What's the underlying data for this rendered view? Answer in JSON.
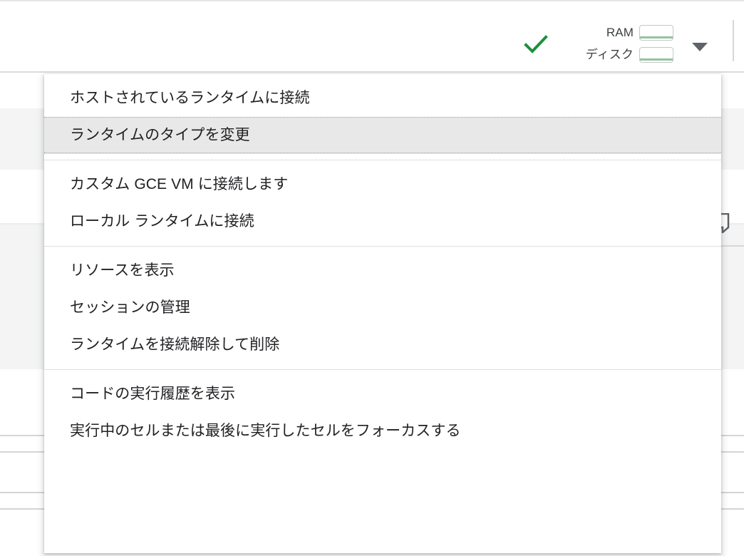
{
  "window": {
    "title": "Colab notebook - runtime menu open"
  },
  "toolbar": {
    "connected_icon": "check-icon",
    "connected_icon_color": "#1e8e3e",
    "resource_meters": [
      {
        "label": "RAM",
        "icon": "usage-bar-icon",
        "fill_color": "#93c49b"
      },
      {
        "label": "ディスク",
        "icon": "usage-bar-icon",
        "fill_color": "#93c49b"
      }
    ],
    "dropdown_caret": "chevron-down-icon"
  },
  "gutter": {
    "comment_icon": "comment-bubble-icon"
  },
  "menu": {
    "groups": [
      {
        "items": [
          {
            "label": "ホストされているランタイムに接続",
            "name": "menu-item-connect-hosted-runtime",
            "highlighted": false
          },
          {
            "label": "ランタイムのタイプを変更",
            "name": "menu-item-change-runtime-type",
            "highlighted": true
          }
        ]
      },
      {
        "items": [
          {
            "label": "カスタム GCE VM に接続します",
            "name": "menu-item-connect-custom-gce-vm",
            "highlighted": false
          },
          {
            "label": "ローカル ランタイムに接続",
            "name": "menu-item-connect-local-runtime",
            "highlighted": false
          }
        ]
      },
      {
        "items": [
          {
            "label": "リソースを表示",
            "name": "menu-item-view-resources",
            "highlighted": false
          },
          {
            "label": "セッションの管理",
            "name": "menu-item-manage-sessions",
            "highlighted": false
          },
          {
            "label": "ランタイムを接続解除して削除",
            "name": "menu-item-disconnect-and-delete-runtime",
            "highlighted": false
          }
        ]
      },
      {
        "items": [
          {
            "label": "コードの実行履歴を表示",
            "name": "menu-item-view-execution-history",
            "highlighted": false
          },
          {
            "label": "実行中のセルまたは最後に実行したセルをフォーカスする",
            "name": "menu-item-focus-running-or-last-executed-cell",
            "highlighted": false
          }
        ]
      }
    ]
  }
}
